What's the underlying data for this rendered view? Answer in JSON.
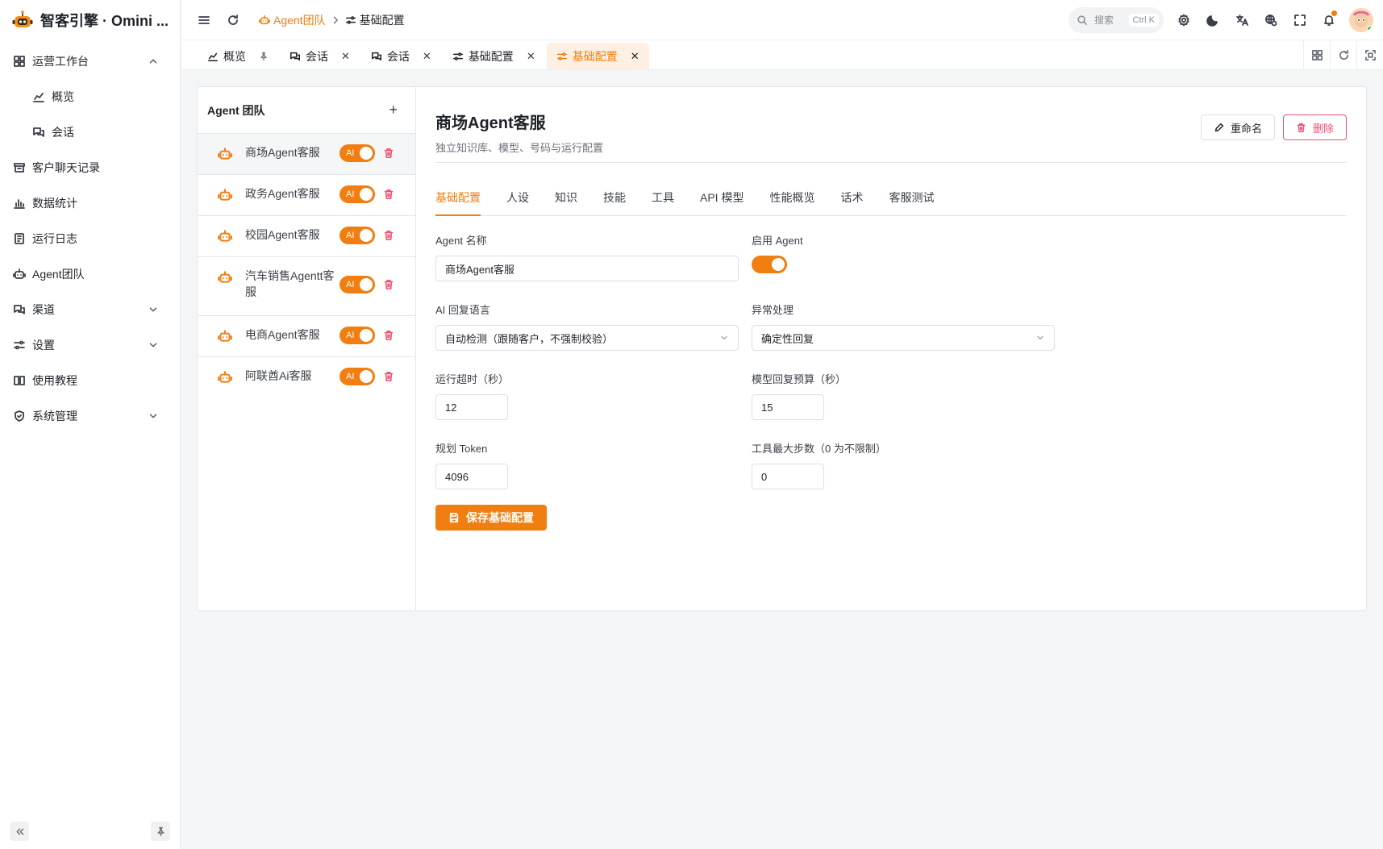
{
  "app": {
    "brand": "智客引擎 · Omini ..."
  },
  "sidebar": {
    "items": [
      {
        "label": "运营工作台"
      },
      {
        "label": "概览"
      },
      {
        "label": "会话"
      },
      {
        "label": "客户聊天记录"
      },
      {
        "label": "数据统计"
      },
      {
        "label": "运行日志"
      },
      {
        "label": "Agent团队"
      },
      {
        "label": "渠道"
      },
      {
        "label": "设置"
      },
      {
        "label": "使用教程"
      },
      {
        "label": "系统管理"
      }
    ]
  },
  "header": {
    "breadcrumb_1": "Agent团队",
    "breadcrumb_2": "基础配置",
    "search_placeholder": "搜索",
    "search_shortcut": "Ctrl K"
  },
  "tabs": [
    {
      "label": "概览"
    },
    {
      "label": "会话"
    },
    {
      "label": "会话"
    },
    {
      "label": "基础配置"
    },
    {
      "label": "基础配置"
    }
  ],
  "agent_list": {
    "title": "Agent 团队",
    "add": "+",
    "switch_label": "AI",
    "agents": [
      {
        "name": "商场Agent客服"
      },
      {
        "name": "政务Agent客服"
      },
      {
        "name": "校园Agent客服"
      },
      {
        "name": "汽车销售Agentt客服"
      },
      {
        "name": "电商Agent客服"
      },
      {
        "name": "阿联酋Ai客服"
      }
    ]
  },
  "detail": {
    "title": "商场Agent客服",
    "subtitle": "独立知识库、模型、号码与运行配置",
    "rename": "重命名",
    "delete": "删除",
    "tabs": [
      "基础配置",
      "人设",
      "知识",
      "技能",
      "工具",
      "API 模型",
      "性能概览",
      "话术",
      "客服测试"
    ],
    "form": {
      "agent_name_label": "Agent 名称",
      "agent_name_value": "商场Agent客服",
      "enable_label": "启用 Agent",
      "lang_label": "AI 回复语言",
      "lang_value": "自动检测（跟随客户，不强制校验）",
      "exception_label": "异常处理",
      "exception_value": "确定性回复",
      "timeout_label": "运行超时（秒）",
      "timeout_value": "12",
      "budget_label": "模型回复预算（秒）",
      "budget_value": "15",
      "token_label": "规划 Token",
      "token_value": "4096",
      "steps_label": "工具最大步数（0 为不限制）",
      "steps_value": "0",
      "save": "保存基础配置"
    }
  },
  "colors": {
    "accent": "#f07e10",
    "danger": "#f0506e"
  }
}
